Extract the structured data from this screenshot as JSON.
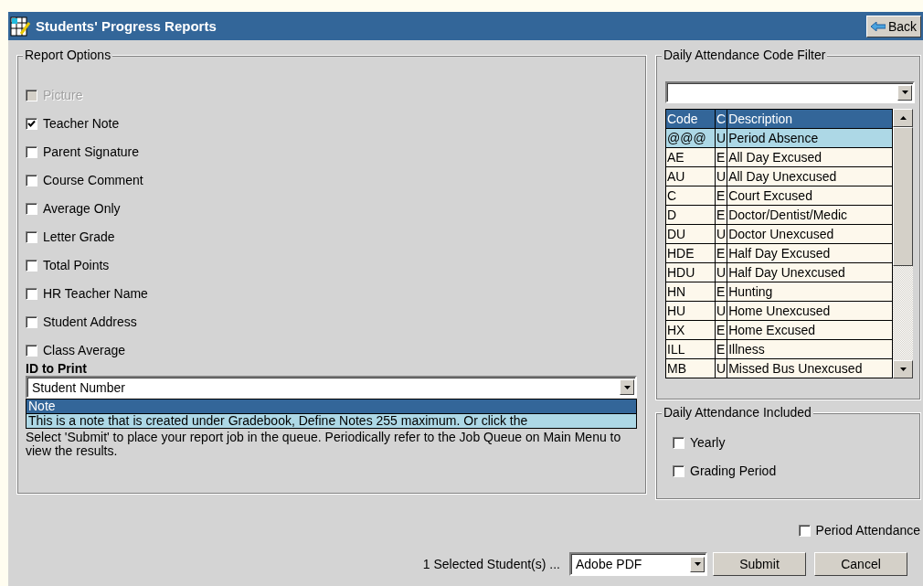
{
  "window": {
    "title": "Students' Progress Reports"
  },
  "back_button": "Back",
  "report_options": {
    "legend": "Report Options",
    "options": [
      {
        "label": "Picture",
        "checked": false,
        "disabled": true
      },
      {
        "label": "Teacher Note",
        "checked": true,
        "disabled": false
      },
      {
        "label": "Parent Signature",
        "checked": false,
        "disabled": false
      },
      {
        "label": "Course Comment",
        "checked": false,
        "disabled": false
      },
      {
        "label": "Average Only",
        "checked": false,
        "disabled": false
      },
      {
        "label": "Letter Grade",
        "checked": false,
        "disabled": false
      },
      {
        "label": "Total Points",
        "checked": false,
        "disabled": false
      },
      {
        "label": "HR Teacher Name",
        "checked": false,
        "disabled": false
      },
      {
        "label": "Student Address",
        "checked": false,
        "disabled": false
      },
      {
        "label": "Class Average",
        "checked": false,
        "disabled": false
      }
    ],
    "id_to_print": {
      "label": "ID to Print",
      "value": "Student Number"
    },
    "note": {
      "header": "Note",
      "text": "This is a note that is created under Gradebook, Define Notes 255 maximum. Or click the"
    },
    "instructions": "Select 'Submit' to place your report job in the queue. Periodically refer to the Job Queue on Main Menu to view the results."
  },
  "code_filter": {
    "legend": "Daily Attendance Code Filter",
    "columns": [
      "Code",
      "C",
      "Description"
    ],
    "rows": [
      {
        "code": "@@@",
        "type": "U",
        "description": "Period Absence",
        "selected": true
      },
      {
        "code": "AE",
        "type": "E",
        "description": "All Day Excused",
        "selected": false
      },
      {
        "code": "AU",
        "type": "U",
        "description": "All Day Unexcused",
        "selected": false
      },
      {
        "code": "C",
        "type": "E",
        "description": "Court Excused",
        "selected": false
      },
      {
        "code": "D",
        "type": "E",
        "description": "Doctor/Dentist/Medic",
        "selected": false
      },
      {
        "code": "DU",
        "type": "U",
        "description": "Doctor Unexcused",
        "selected": false
      },
      {
        "code": "HDE",
        "type": "E",
        "description": "Half Day Excused",
        "selected": false
      },
      {
        "code": "HDU",
        "type": "U",
        "description": "Half Day Unexcused",
        "selected": false
      },
      {
        "code": "HN",
        "type": "E",
        "description": "Hunting",
        "selected": false
      },
      {
        "code": "HU",
        "type": "U",
        "description": "Home Unexcused",
        "selected": false
      },
      {
        "code": "HX",
        "type": "E",
        "description": "Home Excused",
        "selected": false
      },
      {
        "code": "ILL",
        "type": "E",
        "description": "Illness",
        "selected": false
      },
      {
        "code": "MB",
        "type": "U",
        "description": "Missed Bus Unexcused",
        "selected": false
      }
    ]
  },
  "attendance_included": {
    "legend": "Daily Attendance Included",
    "options": [
      {
        "label": "Yearly",
        "checked": false
      },
      {
        "label": "Grading Period",
        "checked": false
      }
    ]
  },
  "period_attendance": {
    "label": "Period Attendance",
    "checked": false
  },
  "footer": {
    "selected_count": "1 Selected Student(s) ...",
    "format": "Adobe PDF",
    "buttons": [
      "Submit",
      "Cancel"
    ]
  }
}
